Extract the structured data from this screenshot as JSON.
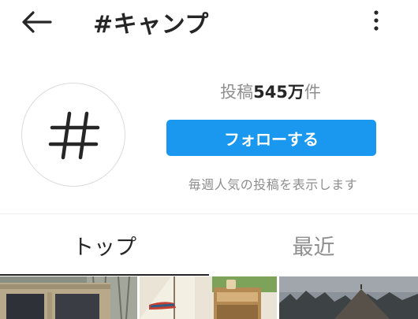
{
  "header": {
    "back_icon": "arrow-left-icon",
    "title": "#キャンプ",
    "more_icon": "more-vertical-icon"
  },
  "hashtag": {
    "avatar_icon": "hashtag-icon",
    "posts_label_prefix": "投稿",
    "posts_count": "545万",
    "posts_label_suffix": "件",
    "follow_label": "フォローする",
    "weekly_note": "毎週人気の投稿を表示します"
  },
  "tabs": [
    {
      "label": "トップ",
      "active": true
    },
    {
      "label": "最近",
      "active": false
    }
  ],
  "colors": {
    "accent": "#1a98f0",
    "text_primary": "#262626",
    "text_secondary": "#8e8e8e"
  }
}
